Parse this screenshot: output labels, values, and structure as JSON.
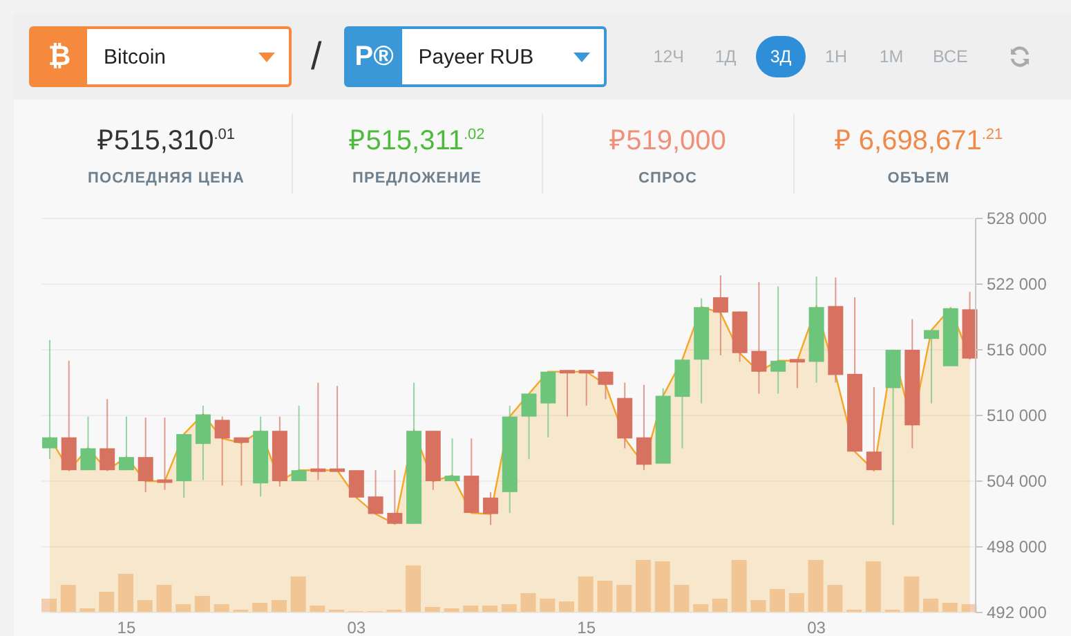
{
  "pairs": [
    {
      "glyph": "₿",
      "label": "Bitcoin",
      "color": "#f5893d"
    },
    {
      "glyph": "P®",
      "label": "Payeer RUB",
      "color": "#3a98d8"
    }
  ],
  "separator": "/",
  "periods": [
    {
      "label": "12Ч",
      "selected": false
    },
    {
      "label": "1Д",
      "selected": false
    },
    {
      "label": "3Д",
      "selected": true
    },
    {
      "label": "1Н",
      "selected": false
    },
    {
      "label": "1М",
      "selected": false
    },
    {
      "label": "ВСЕ",
      "selected": false
    }
  ],
  "stats": [
    {
      "value": "₽515,310$^{.01}$",
      "label": "ПОСЛЕДНЯЯ ЦЕНА",
      "color": "#333333"
    },
    {
      "value": "₽515,311$^{.02}$",
      "label": "ПРЕДЛОЖЕНИЕ",
      "color": "#4cbb3a"
    },
    {
      "value": "₽519,000",
      "label": "СПРОС",
      "color": "#f0907a"
    },
    {
      "value": "₽ 6,698,671$^{.21}$",
      "label": "ОБЪЕМ",
      "color": "#f08a4b"
    }
  ],
  "chart": {
    "date_labels": [
      "15",
      "03",
      "15",
      "03"
    ],
    "chart_data": {
      "type": "candlestick",
      "grid": true,
      "ylim": [
        492000,
        528000
      ],
      "yticks": [
        {
          "value": 492000,
          "label": "492 000"
        },
        {
          "value": 498000,
          "label": "498 000"
        },
        {
          "value": 504000,
          "label": "504 000"
        },
        {
          "value": 510000,
          "label": "510 000"
        },
        {
          "value": 516000,
          "label": "516 000"
        },
        {
          "value": 522000,
          "label": "522 000"
        },
        {
          "value": 528000,
          "label": "528 000"
        }
      ],
      "series": [
        {
          "type": "area",
          "color": "#f5a623",
          "values": [
            508000,
            505000,
            507000,
            505000,
            506200,
            504000,
            504000,
            508300,
            510100,
            507900,
            507500,
            508600,
            504000,
            505000,
            505000,
            505000,
            502500,
            501000,
            500100,
            508600,
            504000,
            504500,
            501100,
            501000,
            509900,
            512000,
            514000,
            514000,
            514000,
            512800,
            507900,
            505500,
            511800,
            515100,
            519900,
            519400,
            515700,
            514000,
            515000,
            515000,
            519900,
            513700,
            506700,
            505000,
            516000,
            509100,
            517800,
            519800,
            515200
          ]
        }
      ],
      "ohlc": [
        [
          507000,
          516900,
          506000,
          508000
        ],
        [
          508000,
          515000,
          505000,
          505000
        ],
        [
          505000,
          509900,
          505000,
          507000
        ],
        [
          507000,
          511500,
          505000,
          505000
        ],
        [
          505000,
          509900,
          505000,
          506200
        ],
        [
          506200,
          509800,
          503000,
          504000
        ],
        [
          504000,
          509800,
          503200,
          504000
        ],
        [
          504000,
          508300,
          502500,
          508300
        ],
        [
          507400,
          510900,
          504100,
          510100
        ],
        [
          509600,
          509900,
          503600,
          507900
        ],
        [
          508000,
          508000,
          503600,
          507500
        ],
        [
          503800,
          509900,
          502600,
          508600
        ],
        [
          508600,
          509900,
          503500,
          504000
        ],
        [
          504000,
          510900,
          504000,
          505000
        ],
        [
          505000,
          513000,
          504100,
          505000
        ],
        [
          505000,
          512700,
          505000,
          505000
        ],
        [
          505000,
          505000,
          502500,
          502500
        ],
        [
          502600,
          505000,
          501000,
          501000
        ],
        [
          501100,
          505000,
          500100,
          500100
        ],
        [
          500100,
          513000,
          500100,
          508600
        ],
        [
          508600,
          508600,
          503200,
          504000
        ],
        [
          504000,
          507900,
          504000,
          504500
        ],
        [
          504500,
          507900,
          501100,
          501100
        ],
        [
          502500,
          503000,
          500000,
          501000
        ],
        [
          503000,
          510900,
          501100,
          509900
        ],
        [
          509900,
          512000,
          506000,
          512000
        ],
        [
          511100,
          514000,
          508000,
          514000
        ],
        [
          514000,
          514000,
          509900,
          514000
        ],
        [
          514000,
          514000,
          510900,
          514000
        ],
        [
          514000,
          514000,
          511500,
          512800
        ],
        [
          511600,
          513000,
          507000,
          507900
        ],
        [
          508000,
          512800,
          505000,
          505500
        ],
        [
          505600,
          512500,
          505600,
          511800
        ],
        [
          511700,
          515100,
          507000,
          515100
        ],
        [
          515100,
          520700,
          511100,
          519900
        ],
        [
          520800,
          522800,
          515500,
          519400
        ],
        [
          519500,
          519500,
          514900,
          515700
        ],
        [
          515900,
          522200,
          512000,
          514000
        ],
        [
          514000,
          521800,
          512000,
          515000
        ],
        [
          515000,
          515000,
          512500,
          515000
        ],
        [
          514900,
          522700,
          513000,
          519900
        ],
        [
          520000,
          522600,
          513000,
          513700
        ],
        [
          513800,
          520800,
          506700,
          506700
        ],
        [
          506700,
          512600,
          505000,
          505000
        ],
        [
          512500,
          516000,
          500000,
          516000
        ],
        [
          516000,
          518800,
          507000,
          509100
        ],
        [
          517000,
          517800,
          511100,
          517800
        ],
        [
          514500,
          519800,
          514500,
          519800
        ],
        [
          519700,
          521300,
          515100,
          515200
        ]
      ]
    }
  }
}
